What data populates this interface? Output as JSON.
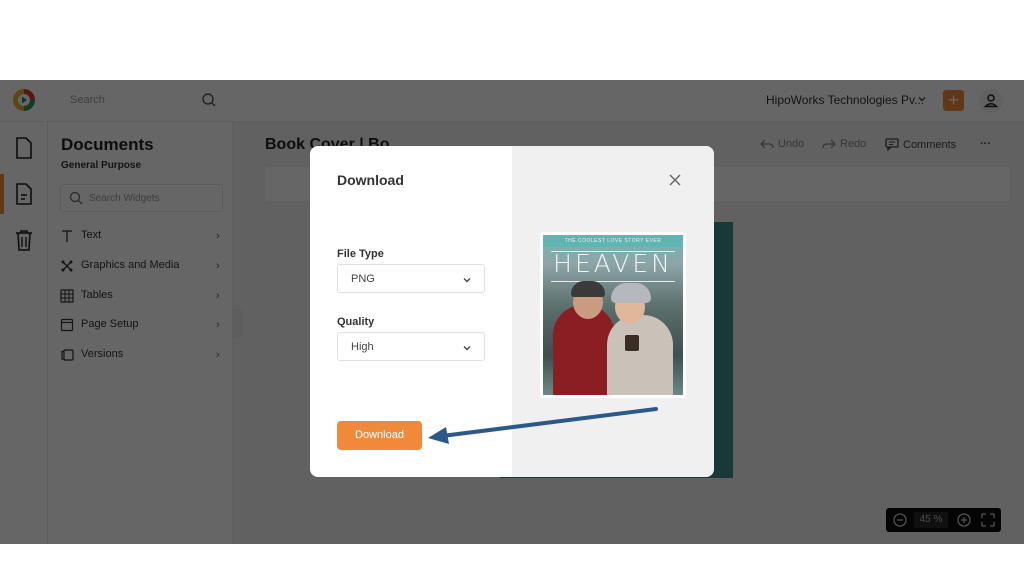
{
  "topbar": {
    "search_placeholder": "Search",
    "org_name": "HipoWorks Technologies Pv...",
    "add_label": "+"
  },
  "rail": {
    "items": [
      {
        "name": "documents",
        "icon": "file-icon"
      },
      {
        "name": "document-text",
        "icon": "file-text-icon",
        "active": true
      },
      {
        "name": "trash",
        "icon": "trash-icon"
      }
    ]
  },
  "panel": {
    "title": "Documents",
    "subtitle": "General Purpose",
    "search_placeholder": "Search Widgets",
    "items": [
      {
        "label": "Text",
        "icon": "text-icon"
      },
      {
        "label": "Graphics and Media",
        "icon": "graphics-icon"
      },
      {
        "label": "Tables",
        "icon": "table-icon"
      },
      {
        "label": "Page Setup",
        "icon": "page-setup-icon"
      },
      {
        "label": "Versions",
        "icon": "versions-icon"
      }
    ],
    "chevron": "›"
  },
  "editor": {
    "doc_title": "Book Cover | Bo",
    "undo_label": "Undo",
    "redo_label": "Redo",
    "comments_label": "Comments",
    "more_label": "···",
    "zoom_value": "45 %"
  },
  "modal": {
    "title": "Download",
    "file_type_label": "File Type",
    "file_type_value": "PNG",
    "quality_label": "Quality",
    "quality_value": "High",
    "download_button": "Download",
    "preview": {
      "tagline": "THE COOLEST LOVE STORY EVER",
      "cover_title": "HEAVEN"
    }
  },
  "colors": {
    "accent": "#f08a3a",
    "annotation_arrow": "#2b5a8a",
    "overlay": "rgba(0,0,0,0.6)"
  }
}
